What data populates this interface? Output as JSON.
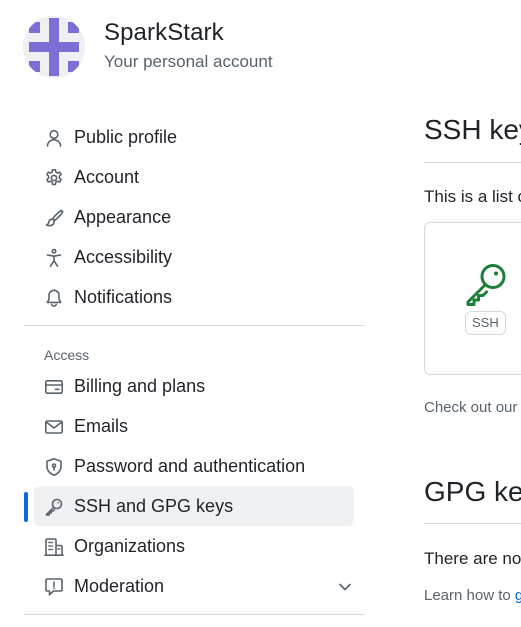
{
  "account": {
    "name": "SparkStark",
    "subtitle": "Your personal account"
  },
  "sidebar": {
    "items_top": [
      {
        "label": "Public profile",
        "icon": "person-icon"
      },
      {
        "label": "Account",
        "icon": "gear-icon"
      },
      {
        "label": "Appearance",
        "icon": "paintbrush-icon"
      },
      {
        "label": "Accessibility",
        "icon": "accessibility-icon"
      },
      {
        "label": "Notifications",
        "icon": "bell-icon"
      }
    ],
    "access_heading": "Access",
    "items_access": [
      {
        "label": "Billing and plans",
        "icon": "credit-card-icon"
      },
      {
        "label": "Emails",
        "icon": "mail-icon"
      },
      {
        "label": "Password and authentication",
        "icon": "shield-lock-icon"
      },
      {
        "label": "SSH and GPG keys",
        "icon": "key-icon",
        "active": true
      },
      {
        "label": "Organizations",
        "icon": "organization-icon"
      },
      {
        "label": "Moderation",
        "icon": "report-icon",
        "expandable": true
      }
    ]
  },
  "main": {
    "ssh_heading": "SSH keys",
    "ssh_intro": "This is a list of",
    "ssh_tag": "SSH",
    "check_out": "Check out our",
    "gpg_heading": "GPG keys",
    "gpg_intro": "There are no",
    "learn_how": "Learn how to",
    "learn_link": "g"
  },
  "colors": {
    "accent": "#0969da",
    "key_green": "#1a7f37",
    "active_bg": "#eff1f3",
    "muted_text": "#59636e",
    "border": "#d1d9e0"
  }
}
